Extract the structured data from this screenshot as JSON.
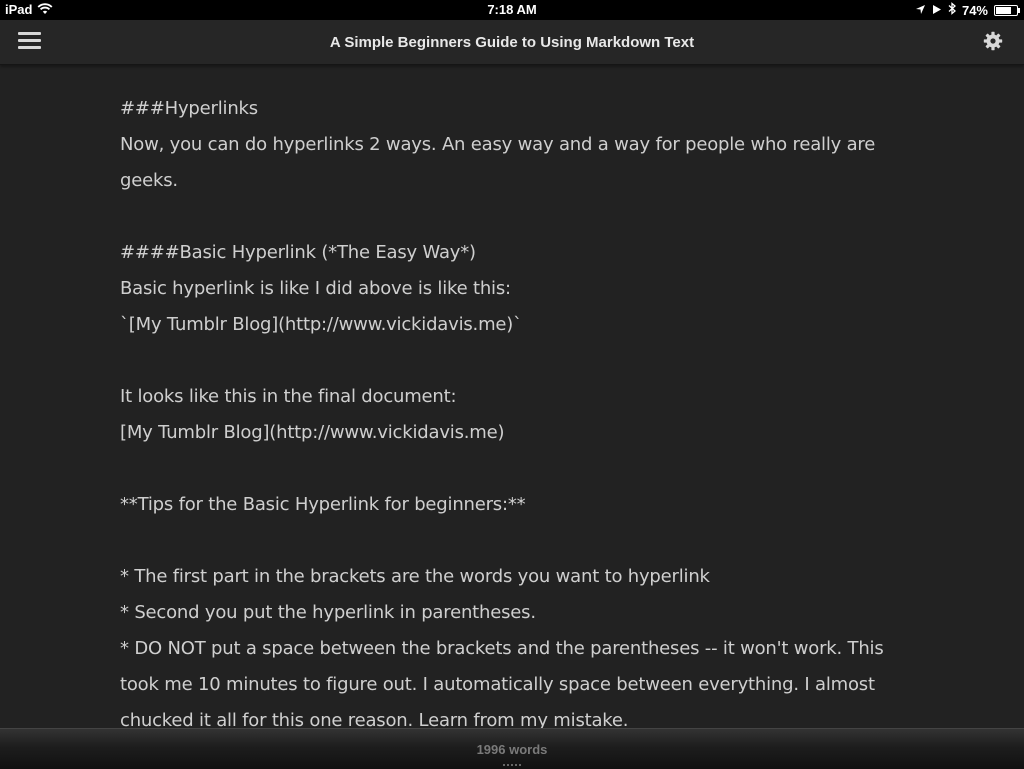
{
  "status_bar": {
    "device": "iPad",
    "time": "7:18 AM",
    "battery": "74%",
    "battery_level": 0.74
  },
  "nav": {
    "title": "A Simple Beginners Guide to Using Markdown Text"
  },
  "editor": {
    "lines": [
      "###Hyperlinks",
      "Now, you can do hyperlinks 2 ways. An easy way and a way for people who really are",
      "geeks.",
      "",
      "####Basic Hyperlink (*The Easy Way*)",
      "Basic hyperlink is like I did above is like this:",
      "`[My Tumblr Blog](http://www.vickidavis.me)`",
      "",
      "It looks like this in the final document:",
      "[My Tumblr Blog](http://www.vickidavis.me)",
      "",
      "**Tips for the Basic Hyperlink for beginners:**",
      "",
      "* The first part in the brackets are the words you want to hyperlink",
      "* Second you put the hyperlink in parentheses.",
      "* DO NOT put a space between the brackets and the parentheses -- it won't work. This",
      "took me 10 minutes to figure out. I automatically space between everything. I almost",
      "chucked it all for this one reason. Learn from my mistake."
    ]
  },
  "footer": {
    "word_count": "1996 words"
  },
  "icons": {
    "menu": "hamburger-menu-icon",
    "settings": "gear-icon",
    "wifi": "wifi-icon",
    "location": "location-arrow-icon",
    "play": "play-icon",
    "bluetooth": "bluetooth-icon",
    "battery": "battery-icon"
  }
}
